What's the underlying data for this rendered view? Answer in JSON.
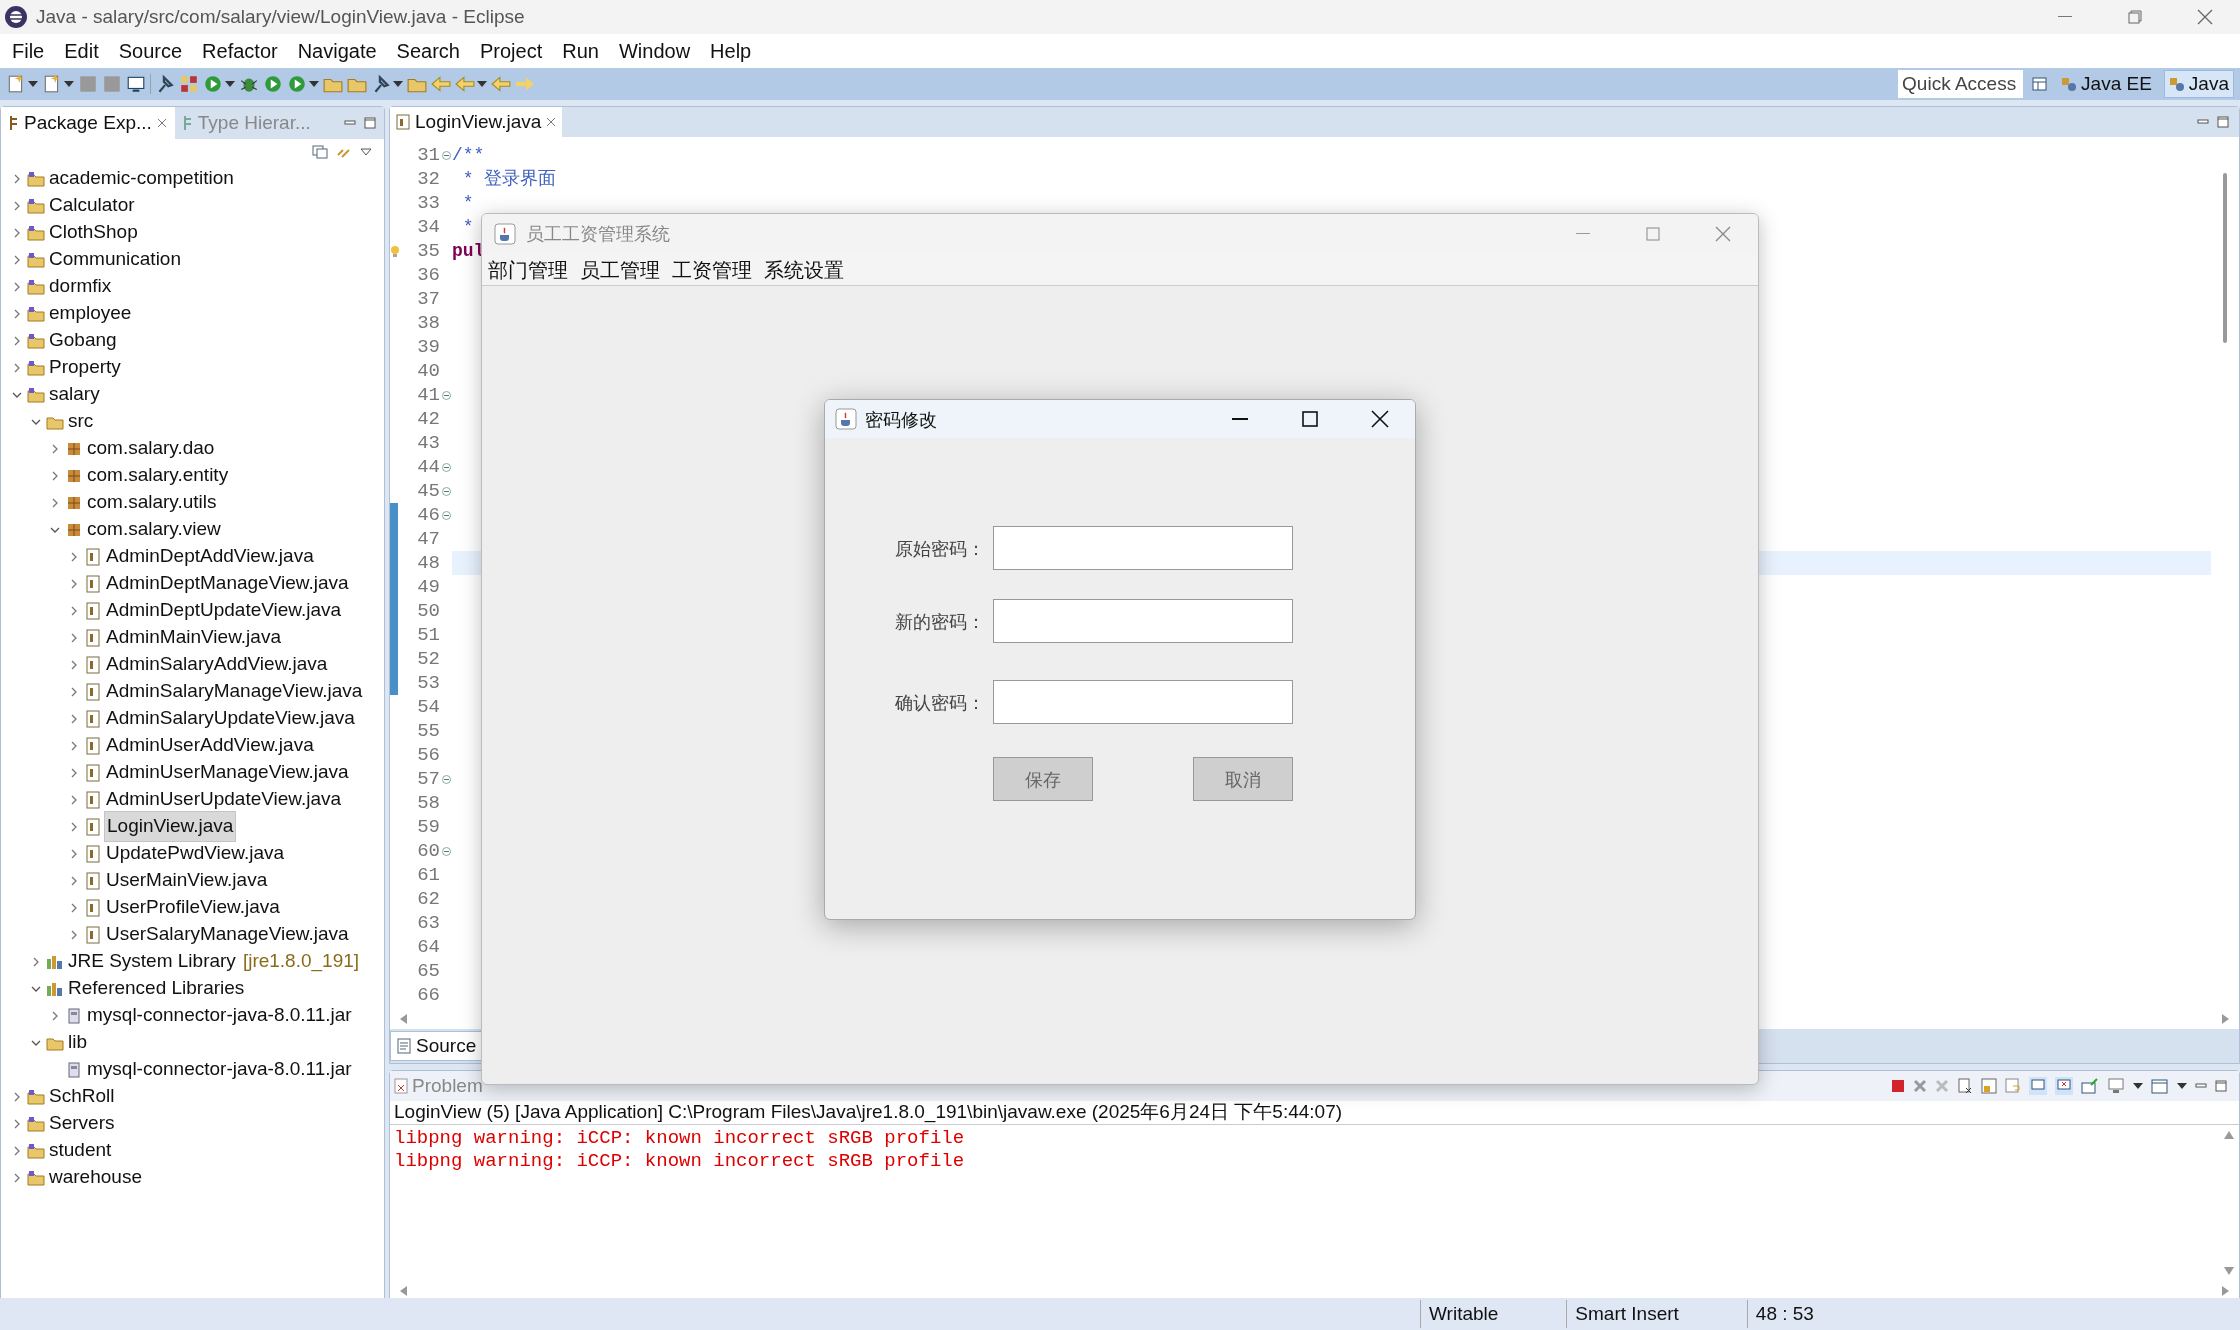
{
  "window": {
    "title": "Java - salary/src/com/salary/view/LoginView.java - Eclipse"
  },
  "menu": [
    "File",
    "Edit",
    "Source",
    "Refactor",
    "Navigate",
    "Search",
    "Project",
    "Run",
    "Window",
    "Help"
  ],
  "toolbar": {
    "quick_access": "Quick Access",
    "perspectives": [
      {
        "label": "Java EE",
        "selected": false
      },
      {
        "label": "Java",
        "selected": true
      }
    ]
  },
  "left_panel": {
    "tabs": [
      {
        "label": "Package Exp...",
        "selected": true
      },
      {
        "label": "Type Hierar...",
        "selected": false
      }
    ],
    "tree": [
      {
        "label": "academic-competition",
        "kind": "project",
        "expanded": false,
        "selected": false
      },
      {
        "label": "Calculator",
        "kind": "project",
        "expanded": false,
        "selected": false
      },
      {
        "label": "ClothShop",
        "kind": "project",
        "expanded": false,
        "selected": false
      },
      {
        "label": "Communication",
        "kind": "project",
        "expanded": false,
        "selected": false
      },
      {
        "label": "dormfix",
        "kind": "project",
        "expanded": false,
        "selected": false
      },
      {
        "label": "employee",
        "kind": "project",
        "expanded": false,
        "selected": false
      },
      {
        "label": "Gobang",
        "kind": "project",
        "expanded": false,
        "selected": false
      },
      {
        "label": "Property",
        "kind": "project",
        "expanded": false,
        "selected": false
      },
      {
        "label": "salary",
        "kind": "project",
        "expanded": true,
        "selected": false,
        "children": [
          {
            "label": "src",
            "kind": "source",
            "expanded": true,
            "selected": false,
            "children": [
              {
                "label": "com.salary.dao",
                "kind": "package",
                "expanded": false,
                "selected": false
              },
              {
                "label": "com.salary.entity",
                "kind": "package",
                "expanded": false,
                "selected": false
              },
              {
                "label": "com.salary.utils",
                "kind": "package",
                "expanded": false,
                "selected": false
              },
              {
                "label": "com.salary.view",
                "kind": "package",
                "expanded": true,
                "selected": false,
                "children": [
                  {
                    "label": "AdminDeptAddView.java",
                    "kind": "file",
                    "expanded": false,
                    "selected": false
                  },
                  {
                    "label": "AdminDeptManageView.java",
                    "kind": "file",
                    "expanded": false,
                    "selected": false
                  },
                  {
                    "label": "AdminDeptUpdateView.java",
                    "kind": "file",
                    "expanded": false,
                    "selected": false
                  },
                  {
                    "label": "AdminMainView.java",
                    "kind": "file",
                    "expanded": false,
                    "selected": false
                  },
                  {
                    "label": "AdminSalaryAddView.java",
                    "kind": "file",
                    "expanded": false,
                    "selected": false
                  },
                  {
                    "label": "AdminSalaryManageView.java",
                    "kind": "file",
                    "expanded": false,
                    "selected": false
                  },
                  {
                    "label": "AdminSalaryUpdateView.java",
                    "kind": "file",
                    "expanded": false,
                    "selected": false
                  },
                  {
                    "label": "AdminUserAddView.java",
                    "kind": "file",
                    "expanded": false,
                    "selected": false
                  },
                  {
                    "label": "AdminUserManageView.java",
                    "kind": "file",
                    "expanded": false,
                    "selected": false
                  },
                  {
                    "label": "AdminUserUpdateView.java",
                    "kind": "file",
                    "expanded": false,
                    "selected": false
                  },
                  {
                    "label": "LoginView.java",
                    "kind": "file",
                    "expanded": false,
                    "selected": true
                  },
                  {
                    "label": "UpdatePwdView.java",
                    "kind": "file",
                    "expanded": false,
                    "selected": false
                  },
                  {
                    "label": "UserMainView.java",
                    "kind": "file",
                    "expanded": false,
                    "selected": false
                  },
                  {
                    "label": "UserProfileView.java",
                    "kind": "file",
                    "expanded": false,
                    "selected": false
                  },
                  {
                    "label": "UserSalaryManageView.java",
                    "kind": "file",
                    "expanded": false,
                    "selected": false
                  }
                ]
              }
            ]
          },
          {
            "label": "JRE System Library",
            "decoration": "[jre1.8.0_191]",
            "kind": "library",
            "expanded": false,
            "selected": false
          },
          {
            "label": "Referenced Libraries",
            "kind": "library",
            "expanded": true,
            "selected": false,
            "children": [
              {
                "label": "mysql-connector-java-8.0.11.jar",
                "kind": "jar",
                "expanded": false,
                "selected": false
              }
            ]
          },
          {
            "label": "lib",
            "kind": "folder",
            "expanded": true,
            "selected": false,
            "children": [
              {
                "label": "mysql-connector-java-8.0.11.jar",
                "kind": "jar",
                "selected": false
              }
            ]
          }
        ]
      },
      {
        "label": "SchRoll",
        "kind": "project",
        "expanded": false,
        "selected": false
      },
      {
        "label": "Servers",
        "kind": "project",
        "expanded": false,
        "selected": false
      },
      {
        "label": "student",
        "kind": "project",
        "expanded": false,
        "selected": false
      },
      {
        "label": "warehouse",
        "kind": "project",
        "expanded": false,
        "selected": false
      }
    ]
  },
  "editor": {
    "tab": "LoginView.java",
    "bottom_tab": "Source",
    "lines": [
      {
        "number": "31",
        "fold": true,
        "code": "/**"
      },
      {
        "number": "32",
        "fold": false,
        "code": " * 登录界面"
      },
      {
        "number": "33",
        "fold": false,
        "code": " *"
      },
      {
        "number": "34",
        "fold": false,
        "code": " *"
      },
      {
        "number": "35",
        "fold": false,
        "code": "pul",
        "warning": true
      },
      {
        "number": "36",
        "fold": false
      },
      {
        "number": "37",
        "fold": false
      },
      {
        "number": "38",
        "fold": false
      },
      {
        "number": "39",
        "fold": false
      },
      {
        "number": "40",
        "fold": false
      },
      {
        "number": "41",
        "fold": true
      },
      {
        "number": "42",
        "fold": false
      },
      {
        "number": "43",
        "fold": false
      },
      {
        "number": "44",
        "fold": true
      },
      {
        "number": "45",
        "fold": true
      },
      {
        "number": "46",
        "fold": true,
        "marked": true
      },
      {
        "number": "47",
        "fold": false,
        "marked": true
      },
      {
        "number": "48",
        "fold": false,
        "marked": true,
        "current": true
      },
      {
        "number": "49",
        "fold": false,
        "marked": true
      },
      {
        "number": "50",
        "fold": false,
        "marked": true
      },
      {
        "number": "51",
        "fold": false,
        "marked": true
      },
      {
        "number": "52",
        "fold": false,
        "marked": true
      },
      {
        "number": "53",
        "fold": false,
        "marked": true
      },
      {
        "number": "54",
        "fold": false
      },
      {
        "number": "55",
        "fold": false
      },
      {
        "number": "56",
        "fold": false
      },
      {
        "number": "57",
        "fold": true
      },
      {
        "number": "58",
        "fold": false
      },
      {
        "number": "59",
        "fold": false
      },
      {
        "number": "60",
        "fold": true
      },
      {
        "number": "61",
        "fold": false
      },
      {
        "number": "62",
        "fold": false
      },
      {
        "number": "63",
        "fold": false
      },
      {
        "number": "64",
        "fold": false
      },
      {
        "number": "65",
        "fold": false
      },
      {
        "number": "66",
        "fold": false
      }
    ]
  },
  "console": {
    "tab": "Problem",
    "launch": "LoginView (5) [Java Application] C:\\Program Files\\Java\\jre1.8.0_191\\bin\\javaw.exe (2025年6月24日 下午5:44:07)",
    "output": [
      "libpng warning: iCCP: known incorrect sRGB profile",
      "libpng warning: iCCP: known incorrect sRGB profile"
    ]
  },
  "status_bar": [
    "Writable",
    "Smart Insert",
    "48 : 53"
  ],
  "app_window": {
    "title": "员工工资管理系统",
    "menu": [
      "部门管理",
      "员工管理",
      "工资管理",
      "系统设置"
    ]
  },
  "dialog": {
    "title": "密码修改",
    "fields": [
      {
        "label": "原始密码："
      },
      {
        "label": "新的密码："
      },
      {
        "label": "确认密码："
      }
    ],
    "buttons": [
      "保存",
      "取消"
    ]
  }
}
